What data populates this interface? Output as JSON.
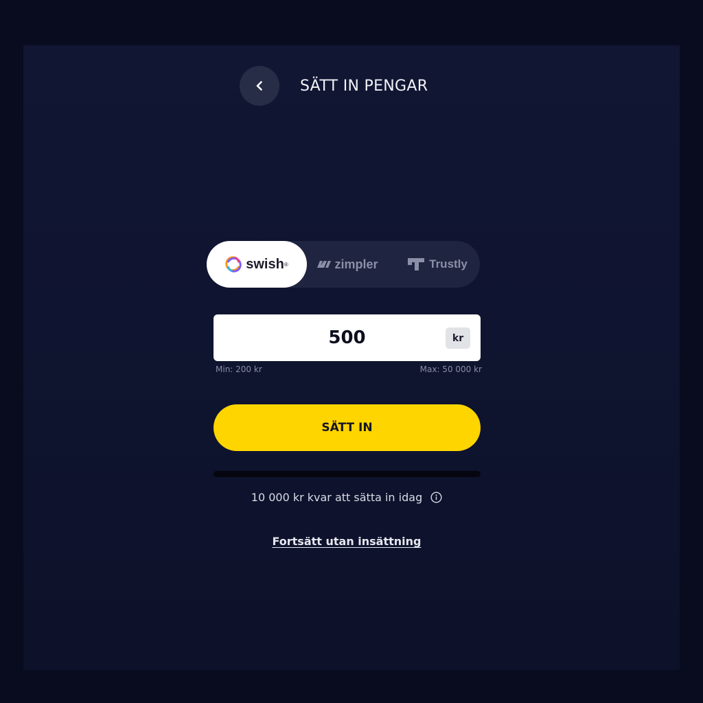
{
  "header": {
    "title": "SÄTT IN PENGAR",
    "back_icon": "chevron-left-icon"
  },
  "payment_methods": {
    "selected": "swish",
    "items": [
      {
        "id": "swish",
        "label": "swish",
        "icon": "swish-logo-icon"
      },
      {
        "id": "zimpler",
        "label": "zimpler",
        "icon": "zimpler-logo-icon"
      },
      {
        "id": "trustly",
        "label": "Trustly",
        "icon": "trustly-logo-icon"
      }
    ]
  },
  "amount": {
    "value": "500",
    "currency": "kr",
    "min_label": "Min: 200 kr",
    "max_label": "Max: 50 000 kr"
  },
  "deposit": {
    "button_label": "SÄTT IN"
  },
  "deposit_limit": {
    "progress_fraction": 0,
    "remaining_text": "10 000 kr kvar att sätta in idag",
    "info_icon": "info-icon"
  },
  "skip": {
    "link_label": "Fortsätt utan insättning"
  },
  "colors": {
    "background": "#0f1430",
    "accent": "#ffd500",
    "selected_method_bg": "#ffffff",
    "method_switch_bg": "#1f2440",
    "muted_text": "#8a8ea8"
  }
}
